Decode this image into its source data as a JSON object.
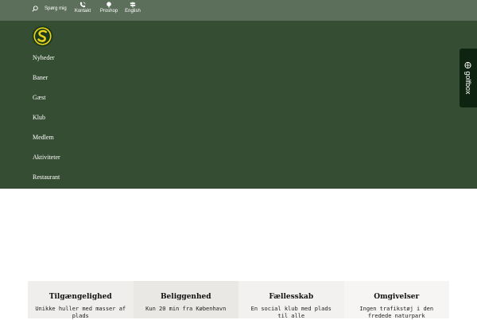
{
  "topbar": {
    "search_label": "Spørg mig",
    "links": [
      {
        "label": "Kontakt",
        "icon": "phone-icon"
      },
      {
        "label": "Proshop",
        "icon": "golf-ball-icon"
      },
      {
        "label": "English",
        "icon": "signpost-icon"
      }
    ]
  },
  "nav": {
    "logo_icon": "club-logo-icon",
    "items": [
      "Nyheder",
      "Baner",
      "Gæst",
      "Klub",
      "Medlem",
      "Aktiviteter",
      "Restaurant"
    ]
  },
  "golfbox": {
    "label": "golfbox",
    "icon": "golf-ball-icon"
  },
  "features": [
    {
      "title": "Tilgængelighed",
      "desc": "Unikke huller med masser af plads"
    },
    {
      "title": "Beliggenhed",
      "desc": "Kun 20 min fra København"
    },
    {
      "title": "Fællesskab",
      "desc": "En social klub med plads til alle"
    },
    {
      "title": "Omgivelser",
      "desc": "Ingen trafikstøj i den fredede naturpark"
    }
  ],
  "colors": {
    "topbar": "#5b6f5a",
    "nav": "#354d33",
    "golfbox_tab": "#0f2410",
    "logo_yellow": "#e8d21a",
    "feature_bg_1": "#efeeec",
    "feature_bg_2": "#e9e8e5",
    "feature_bg_3": "#f2f1ef",
    "feature_bg_4": "#f6f5f3"
  }
}
